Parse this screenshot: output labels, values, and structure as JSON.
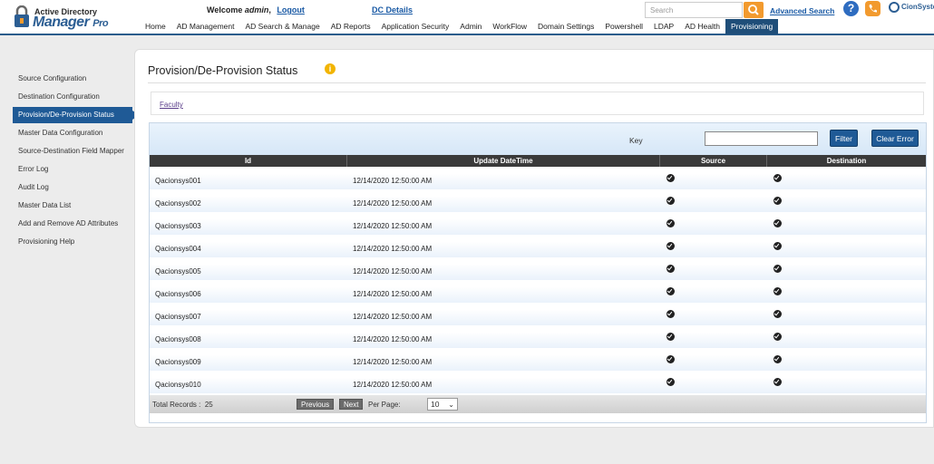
{
  "header": {
    "logo_top": "Active Directory",
    "logo_main": "Manager",
    "logo_pro": "Pro",
    "welcome_prefix": "Welcome",
    "welcome_user": "admin",
    "logout": "Logout",
    "dc_details": "DC Details",
    "search_placeholder": "Search",
    "advanced_search": "Advanced Search",
    "help_glyph": "?",
    "company": "CionSyste"
  },
  "nav": [
    {
      "label": "Home"
    },
    {
      "label": "AD Management"
    },
    {
      "label": "AD Search & Manage"
    },
    {
      "label": "AD Reports"
    },
    {
      "label": "Application Security"
    },
    {
      "label": "Admin"
    },
    {
      "label": "WorkFlow"
    },
    {
      "label": "Domain Settings"
    },
    {
      "label": "Powershell"
    },
    {
      "label": "LDAP"
    },
    {
      "label": "AD Health"
    },
    {
      "label": "Provisioning",
      "active": true
    }
  ],
  "sidebar": [
    {
      "label": "Source Configuration"
    },
    {
      "label": "Destination Configuration"
    },
    {
      "label": "Provision/De-Provision Status",
      "active": true
    },
    {
      "label": "Master Data Configuration"
    },
    {
      "label": "Source-Destination Field Mapper"
    },
    {
      "label": "Error Log"
    },
    {
      "label": "Audit Log"
    },
    {
      "label": "Master Data List"
    },
    {
      "label": "Add and Remove AD Attributes"
    },
    {
      "label": "Provisioning Help"
    }
  ],
  "page": {
    "title": "Provision/De-Provision Status",
    "info_glyph": "i",
    "faculty_link": "Faculty"
  },
  "grid": {
    "key_label": "Key",
    "key_value": "",
    "filter_button": "Filter",
    "clear_error_button": "Clear Error",
    "columns": [
      "Id",
      "Update DateTime",
      "Source",
      "Destination"
    ],
    "rows": [
      {
        "id": "Qacionsys001",
        "datetime": "12/14/2020 12:50:00 AM",
        "source": true,
        "destination": true
      },
      {
        "id": "Qacionsys002",
        "datetime": "12/14/2020 12:50:00 AM",
        "source": true,
        "destination": true
      },
      {
        "id": "Qacionsys003",
        "datetime": "12/14/2020 12:50:00 AM",
        "source": true,
        "destination": true
      },
      {
        "id": "Qacionsys004",
        "datetime": "12/14/2020 12:50:00 AM",
        "source": true,
        "destination": true
      },
      {
        "id": "Qacionsys005",
        "datetime": "12/14/2020 12:50:00 AM",
        "source": true,
        "destination": true
      },
      {
        "id": "Qacionsys006",
        "datetime": "12/14/2020 12:50:00 AM",
        "source": true,
        "destination": true
      },
      {
        "id": "Qacionsys007",
        "datetime": "12/14/2020 12:50:00 AM",
        "source": true,
        "destination": true
      },
      {
        "id": "Qacionsys008",
        "datetime": "12/14/2020 12:50:00 AM",
        "source": true,
        "destination": true
      },
      {
        "id": "Qacionsys009",
        "datetime": "12/14/2020 12:50:00 AM",
        "source": true,
        "destination": true
      },
      {
        "id": "Qacionsys010",
        "datetime": "12/14/2020 12:50:00 AM",
        "source": true,
        "destination": true
      }
    ],
    "total_label": "Total Records :",
    "total_value": "25",
    "previous": "Previous",
    "next": "Next",
    "per_page_label": "Per Page:",
    "per_page_value": "10"
  },
  "colors": {
    "accent": "#1f4e79",
    "header_border": "#2b5d8c",
    "search_button": "#f29a2e",
    "info_icon": "#f2b400"
  }
}
